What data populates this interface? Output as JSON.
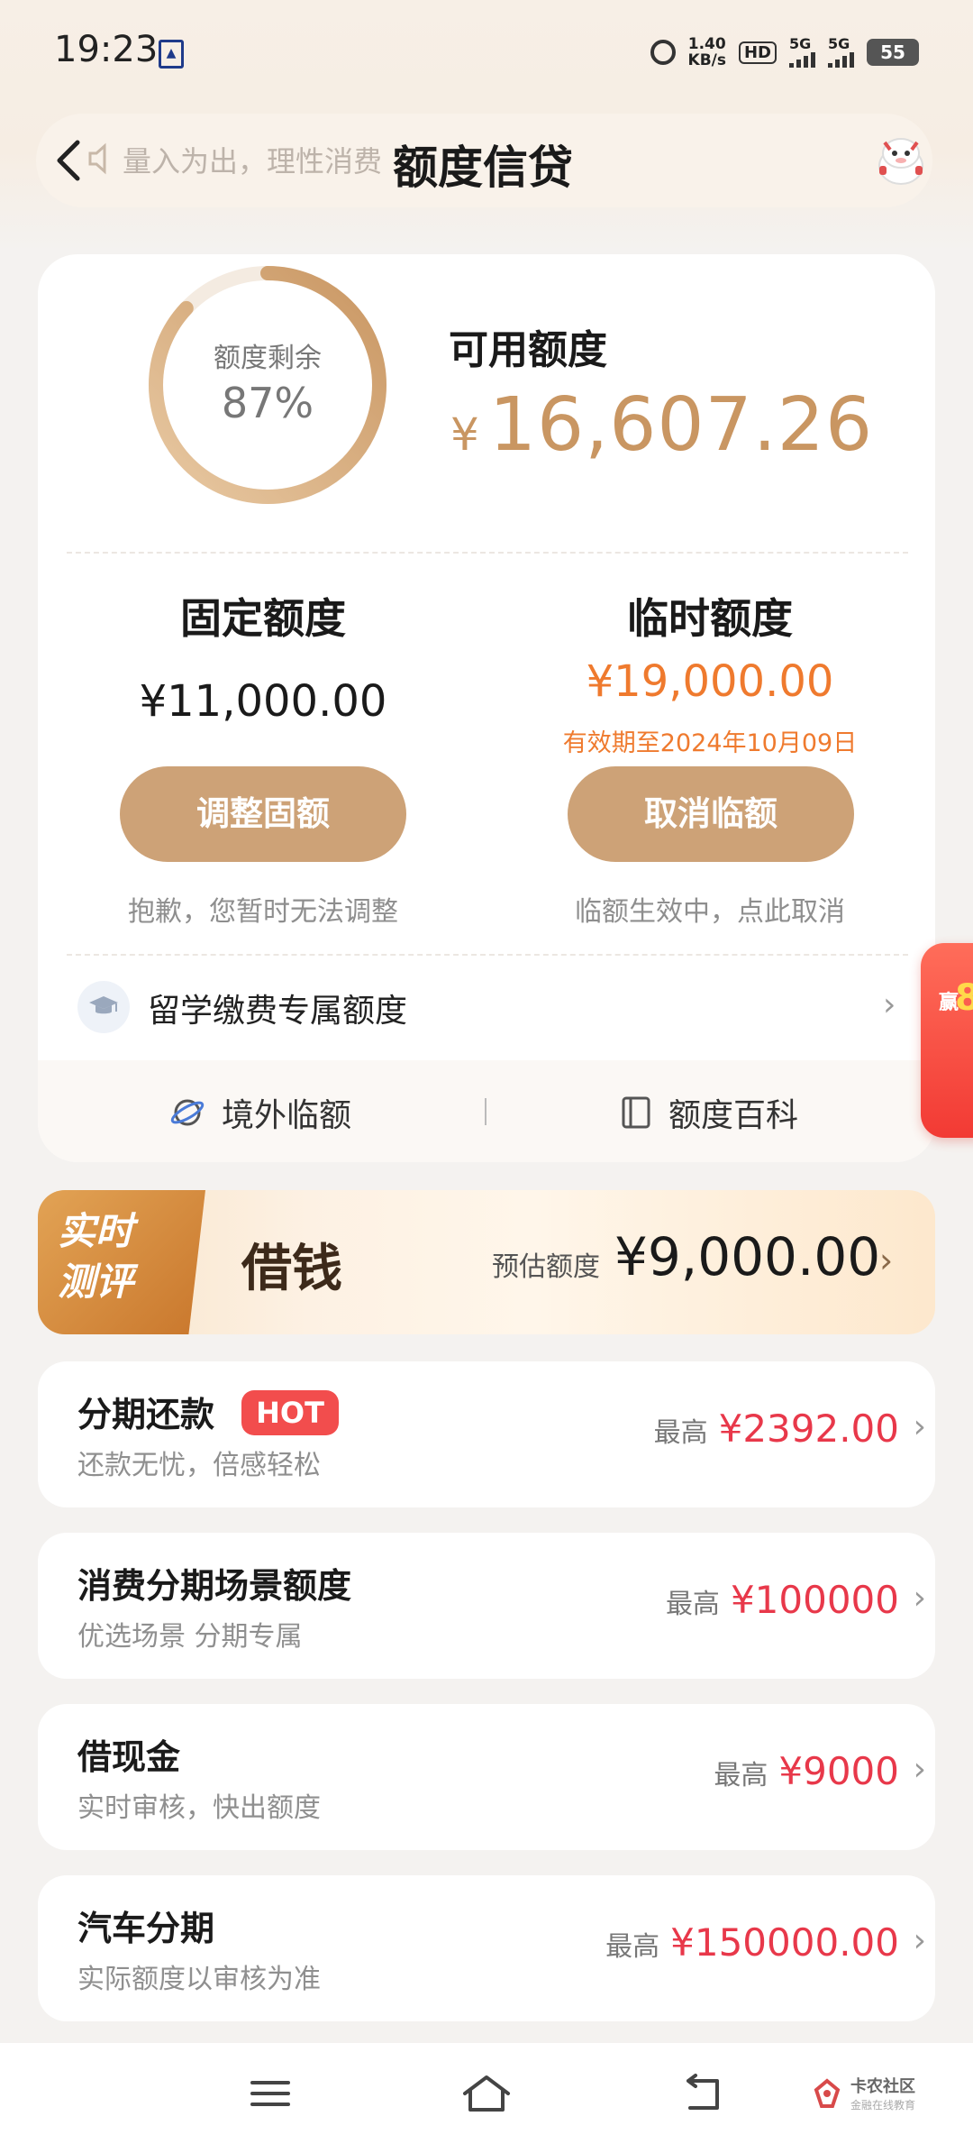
{
  "status_bar": {
    "time": "19:23",
    "net_speed_value": "1.40",
    "net_speed_unit": "KB/s",
    "hd_label": "HD",
    "sim1_label": "5G",
    "sim2_label": "5G",
    "battery": "55"
  },
  "header": {
    "back_icon": "chevron-left-icon",
    "marquee_text": "量入为出，理性消费",
    "title": "额度信贷",
    "mascot_icon": "mascot-icon"
  },
  "credit_summary": {
    "ring_label": "额度剩余",
    "ring_percent_text": "87%",
    "ring_fraction": 0.87,
    "available_label": "可用额度",
    "available_currency": "¥",
    "available_amount": "16,607.26"
  },
  "fixed_quota": {
    "heading": "固定额度",
    "amount": "¥11,000.00",
    "button_label": "调整固额",
    "note": "抱歉，您暂时无法调整"
  },
  "temp_quota": {
    "heading": "临时额度",
    "amount": "¥19,000.00",
    "valid_until": "有效期至2024年10月09日",
    "button_label": "取消临额",
    "note": "临额生效中，点此取消"
  },
  "study_abroad": {
    "label": "留学缴费专属额度",
    "icon": "graduation-cap-icon"
  },
  "footer_links": {
    "overseas_label": "境外临额",
    "overseas_icon": "planet-icon",
    "wiki_label": "额度百科",
    "wiki_icon": "book-icon"
  },
  "side_promo": {
    "text_1": "赢",
    "text_2": "8"
  },
  "loan_banner": {
    "tag_line1": "实时",
    "tag_line2": "测评",
    "title": "借钱",
    "estimate_label": "预估额度",
    "estimate_value": "¥9,000.00"
  },
  "products": [
    {
      "title": "分期还款",
      "badge": "HOT",
      "subtitle": "还款无忧，倍感轻松",
      "max_label": "最高",
      "value": "¥2392.00"
    },
    {
      "title": "消费分期场景额度",
      "subtitle": "优选场景 分期专属",
      "max_label": "最高",
      "value": "¥100000"
    },
    {
      "title": "借现金",
      "subtitle": "实时审核，快出额度",
      "max_label": "最高",
      "value": "¥9000"
    },
    {
      "title": "汽车分期",
      "subtitle": "实际额度以审核为准",
      "max_label": "最高",
      "value": "¥150000.00"
    }
  ],
  "bottom_nav": {
    "menu_icon": "menu-icon",
    "home_icon": "home-icon",
    "back_icon": "back-icon"
  },
  "watermark": {
    "title": "卡农社区",
    "subtitle": "金融在线教育"
  },
  "colors": {
    "accent_gold": "#cda277",
    "amount_gold": "#c99662",
    "temp_orange": "#ef7a2e",
    "price_red": "#e8384a",
    "hot_red": "#f24d4d"
  }
}
